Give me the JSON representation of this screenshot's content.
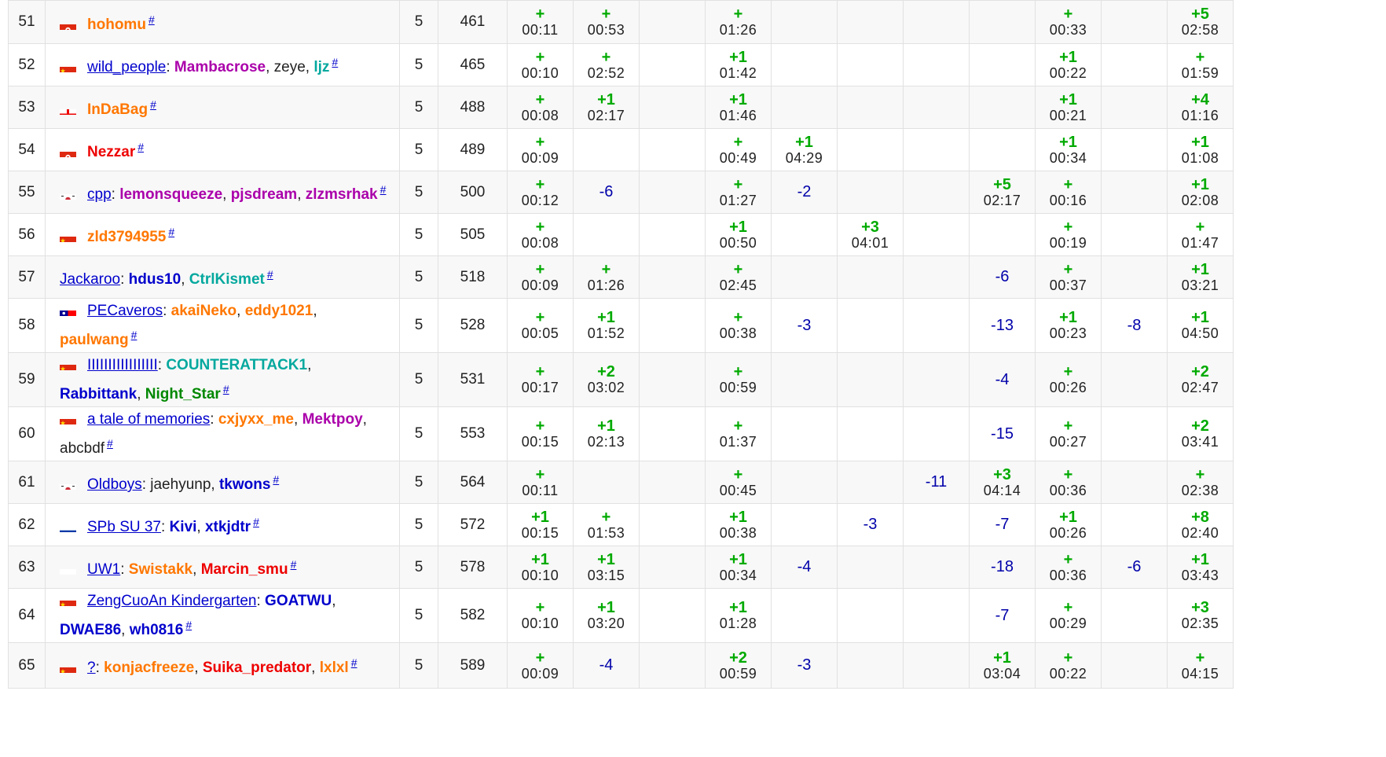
{
  "colors": {
    "accepted": "#00aa00",
    "rejected": "#0000aa",
    "link": "#0000cc",
    "orange": "#ff7700",
    "red": "#ee0000",
    "violet": "#aa00aa",
    "blue": "#0000cc",
    "cyan": "#03a89e",
    "green": "#008800"
  },
  "rows": [
    {
      "rank": "51",
      "flag": "hk",
      "team": "hohomu",
      "team_color": "orange",
      "team_is_link": false,
      "members": [],
      "solved": "5",
      "penalty": "461",
      "cells": [
        {
          "r": "+",
          "t": "00:11"
        },
        {
          "r": "+",
          "t": "00:53"
        },
        {},
        {
          "r": "+",
          "t": "01:26"
        },
        {},
        {},
        {},
        {},
        {
          "r": "+",
          "t": "00:33"
        },
        {},
        {
          "r": "+5",
          "t": "02:58"
        }
      ]
    },
    {
      "rank": "52",
      "flag": "cn",
      "team": "wild_people",
      "team_is_link": true,
      "members": [
        {
          "n": "Mambacrose",
          "c": "violet"
        },
        {
          "n": "zeye",
          "c": "gray"
        },
        {
          "n": "ljz",
          "c": "cyan"
        }
      ],
      "solved": "5",
      "penalty": "465",
      "cells": [
        {
          "r": "+",
          "t": "00:10"
        },
        {
          "r": "+",
          "t": "02:52"
        },
        {},
        {
          "r": "+1",
          "t": "01:42"
        },
        {},
        {},
        {},
        {},
        {
          "r": "+1",
          "t": "00:22"
        },
        {},
        {
          "r": "+",
          "t": "01:59"
        }
      ]
    },
    {
      "rank": "53",
      "flag": "ge",
      "team": "InDaBag",
      "team_color": "orange",
      "team_is_link": false,
      "members": [],
      "solved": "5",
      "penalty": "488",
      "cells": [
        {
          "r": "+",
          "t": "00:08"
        },
        {
          "r": "+1",
          "t": "02:17"
        },
        {},
        {
          "r": "+1",
          "t": "01:46"
        },
        {},
        {},
        {},
        {},
        {
          "r": "+1",
          "t": "00:21"
        },
        {},
        {
          "r": "+4",
          "t": "01:16"
        }
      ]
    },
    {
      "rank": "54",
      "flag": "hk",
      "team": "Nezzar",
      "team_color": "red",
      "team_is_link": false,
      "members": [],
      "solved": "5",
      "penalty": "489",
      "cells": [
        {
          "r": "+",
          "t": "00:09"
        },
        {},
        {},
        {
          "r": "+",
          "t": "00:49"
        },
        {
          "r": "+1",
          "t": "04:29"
        },
        {},
        {},
        {},
        {
          "r": "+1",
          "t": "00:34"
        },
        {},
        {
          "r": "+1",
          "t": "01:08"
        }
      ]
    },
    {
      "rank": "55",
      "flag": "kr",
      "team": "cpp",
      "team_is_link": true,
      "members": [
        {
          "n": "lemonsqueeze",
          "c": "violet"
        },
        {
          "n": "pjsdream",
          "c": "violet"
        },
        {
          "n": "zlzmsrhak",
          "c": "violet"
        }
      ],
      "solved": "5",
      "penalty": "500",
      "cells": [
        {
          "r": "+",
          "t": "00:12"
        },
        {
          "x": "-6"
        },
        {},
        {
          "r": "+",
          "t": "01:27"
        },
        {
          "x": "-2"
        },
        {},
        {},
        {
          "r": "+5",
          "t": "02:17"
        },
        {
          "r": "+",
          "t": "00:16"
        },
        {},
        {
          "r": "+1",
          "t": "02:08"
        }
      ]
    },
    {
      "rank": "56",
      "flag": "cn",
      "team": "zld3794955",
      "team_color": "orange",
      "team_is_link": false,
      "members": [],
      "solved": "5",
      "penalty": "505",
      "cells": [
        {
          "r": "+",
          "t": "00:08"
        },
        {},
        {},
        {
          "r": "+1",
          "t": "00:50"
        },
        {},
        {
          "r": "+3",
          "t": "04:01"
        },
        {},
        {},
        {
          "r": "+",
          "t": "00:19"
        },
        {},
        {
          "r": "+",
          "t": "01:47"
        }
      ]
    },
    {
      "rank": "57",
      "flag": "",
      "team": "Jackaroo",
      "team_is_link": true,
      "members": [
        {
          "n": "hdus10",
          "c": "blue"
        },
        {
          "n": "CtrlKismet",
          "c": "cyan"
        }
      ],
      "solved": "5",
      "penalty": "518",
      "cells": [
        {
          "r": "+",
          "t": "00:09"
        },
        {
          "r": "+",
          "t": "01:26"
        },
        {},
        {
          "r": "+",
          "t": "02:45"
        },
        {},
        {},
        {},
        {
          "x": "-6"
        },
        {
          "r": "+",
          "t": "00:37"
        },
        {},
        {
          "r": "+1",
          "t": "03:21"
        }
      ]
    },
    {
      "rank": "58",
      "flag": "tw",
      "team": "PECaveros",
      "team_is_link": true,
      "members": [
        {
          "n": "akaiNeko",
          "c": "orange"
        },
        {
          "n": "eddy1021",
          "c": "orange"
        },
        {
          "n": "paulwang",
          "c": "orange"
        }
      ],
      "solved": "5",
      "penalty": "528",
      "cells": [
        {
          "r": "+",
          "t": "00:05"
        },
        {
          "r": "+1",
          "t": "01:52"
        },
        {},
        {
          "r": "+",
          "t": "00:38"
        },
        {
          "x": "-3"
        },
        {},
        {},
        {
          "x": "-13"
        },
        {
          "r": "+1",
          "t": "00:23"
        },
        {
          "x": "-8"
        },
        {
          "r": "+1",
          "t": "04:50"
        }
      ]
    },
    {
      "rank": "59",
      "flag": "cn",
      "team": "IIIIIIIIIIIIIIIII",
      "team_is_link": true,
      "members": [
        {
          "n": "COUNTERATTACK1",
          "c": "cyan"
        },
        {
          "n": "Rabbittank",
          "c": "blue"
        },
        {
          "n": "Night_Star",
          "c": "green"
        }
      ],
      "solved": "5",
      "penalty": "531",
      "cells": [
        {
          "r": "+",
          "t": "00:17"
        },
        {
          "r": "+2",
          "t": "03:02"
        },
        {},
        {
          "r": "+",
          "t": "00:59"
        },
        {},
        {},
        {},
        {
          "x": "-4"
        },
        {
          "r": "+",
          "t": "00:26"
        },
        {},
        {
          "r": "+2",
          "t": "02:47"
        }
      ]
    },
    {
      "rank": "60",
      "flag": "cn",
      "team": "a tale of memories",
      "team_is_link": true,
      "members": [
        {
          "n": "cxjyxx_me",
          "c": "orange"
        },
        {
          "n": "Mektpoy",
          "c": "violet"
        },
        {
          "n": "abcbdf",
          "c": "gray"
        }
      ],
      "solved": "5",
      "penalty": "553",
      "cells": [
        {
          "r": "+",
          "t": "00:15"
        },
        {
          "r": "+1",
          "t": "02:13"
        },
        {},
        {
          "r": "+",
          "t": "01:37"
        },
        {},
        {},
        {},
        {
          "x": "-15"
        },
        {
          "r": "+",
          "t": "00:27"
        },
        {},
        {
          "r": "+2",
          "t": "03:41"
        }
      ]
    },
    {
      "rank": "61",
      "flag": "kr",
      "team": "Oldboys",
      "team_is_link": true,
      "members": [
        {
          "n": "jaehyunp",
          "c": "gray"
        },
        {
          "n": "tkwons",
          "c": "blue"
        }
      ],
      "solved": "5",
      "penalty": "564",
      "cells": [
        {
          "r": "+",
          "t": "00:11"
        },
        {},
        {},
        {
          "r": "+",
          "t": "00:45"
        },
        {},
        {},
        {
          "x": "-11"
        },
        {
          "r": "+3",
          "t": "04:14"
        },
        {
          "r": "+",
          "t": "00:36"
        },
        {},
        {
          "r": "+",
          "t": "02:38"
        }
      ]
    },
    {
      "rank": "62",
      "flag": "ru",
      "team": "SPb SU 37",
      "team_is_link": true,
      "members": [
        {
          "n": "Kivi",
          "c": "blue"
        },
        {
          "n": "xtkjdtr",
          "c": "blue"
        }
      ],
      "solved": "5",
      "penalty": "572",
      "cells": [
        {
          "r": "+1",
          "t": "00:15"
        },
        {
          "r": "+",
          "t": "01:53"
        },
        {},
        {
          "r": "+1",
          "t": "00:38"
        },
        {},
        {
          "x": "-3"
        },
        {},
        {
          "x": "-7"
        },
        {
          "r": "+1",
          "t": "00:26"
        },
        {},
        {
          "r": "+8",
          "t": "02:40"
        }
      ]
    },
    {
      "rank": "63",
      "flag": "pl",
      "team": "UW1",
      "team_is_link": true,
      "members": [
        {
          "n": "Swistakk",
          "c": "orange"
        },
        {
          "n": "Marcin_smu",
          "c": "red"
        }
      ],
      "solved": "5",
      "penalty": "578",
      "cells": [
        {
          "r": "+1",
          "t": "00:10"
        },
        {
          "r": "+1",
          "t": "03:15"
        },
        {},
        {
          "r": "+1",
          "t": "00:34"
        },
        {
          "x": "-4"
        },
        {},
        {},
        {
          "x": "-18"
        },
        {
          "r": "+",
          "t": "00:36"
        },
        {
          "x": "-6"
        },
        {
          "r": "+1",
          "t": "03:43"
        }
      ]
    },
    {
      "rank": "64",
      "flag": "cn",
      "team": "ZengCuoAn Kindergarten",
      "team_is_link": true,
      "members": [
        {
          "n": "GOATWU",
          "c": "blue"
        },
        {
          "n": "DWAE86",
          "c": "blue"
        },
        {
          "n": "wh0816",
          "c": "blue"
        }
      ],
      "solved": "5",
      "penalty": "582",
      "cells": [
        {
          "r": "+",
          "t": "00:10"
        },
        {
          "r": "+1",
          "t": "03:20"
        },
        {},
        {
          "r": "+1",
          "t": "01:28"
        },
        {},
        {},
        {},
        {
          "x": "-7"
        },
        {
          "r": "+",
          "t": "00:29"
        },
        {},
        {
          "r": "+3",
          "t": "02:35"
        }
      ]
    },
    {
      "rank": "65",
      "flag": "cn",
      "team": "?",
      "team_is_link": true,
      "members": [
        {
          "n": "konjacfreeze",
          "c": "orange"
        },
        {
          "n": "Suika_predator",
          "c": "red"
        },
        {
          "n": "lxlxl",
          "c": "orange"
        }
      ],
      "solved": "5",
      "penalty": "589",
      "cells": [
        {
          "r": "+",
          "t": "00:09"
        },
        {
          "x": "-4"
        },
        {},
        {
          "r": "+2",
          "t": "00:59"
        },
        {
          "x": "-3"
        },
        {},
        {},
        {
          "r": "+1",
          "t": "03:04"
        },
        {
          "r": "+",
          "t": "00:22"
        },
        {},
        {
          "r": "+",
          "t": "04:15"
        }
      ]
    }
  ]
}
